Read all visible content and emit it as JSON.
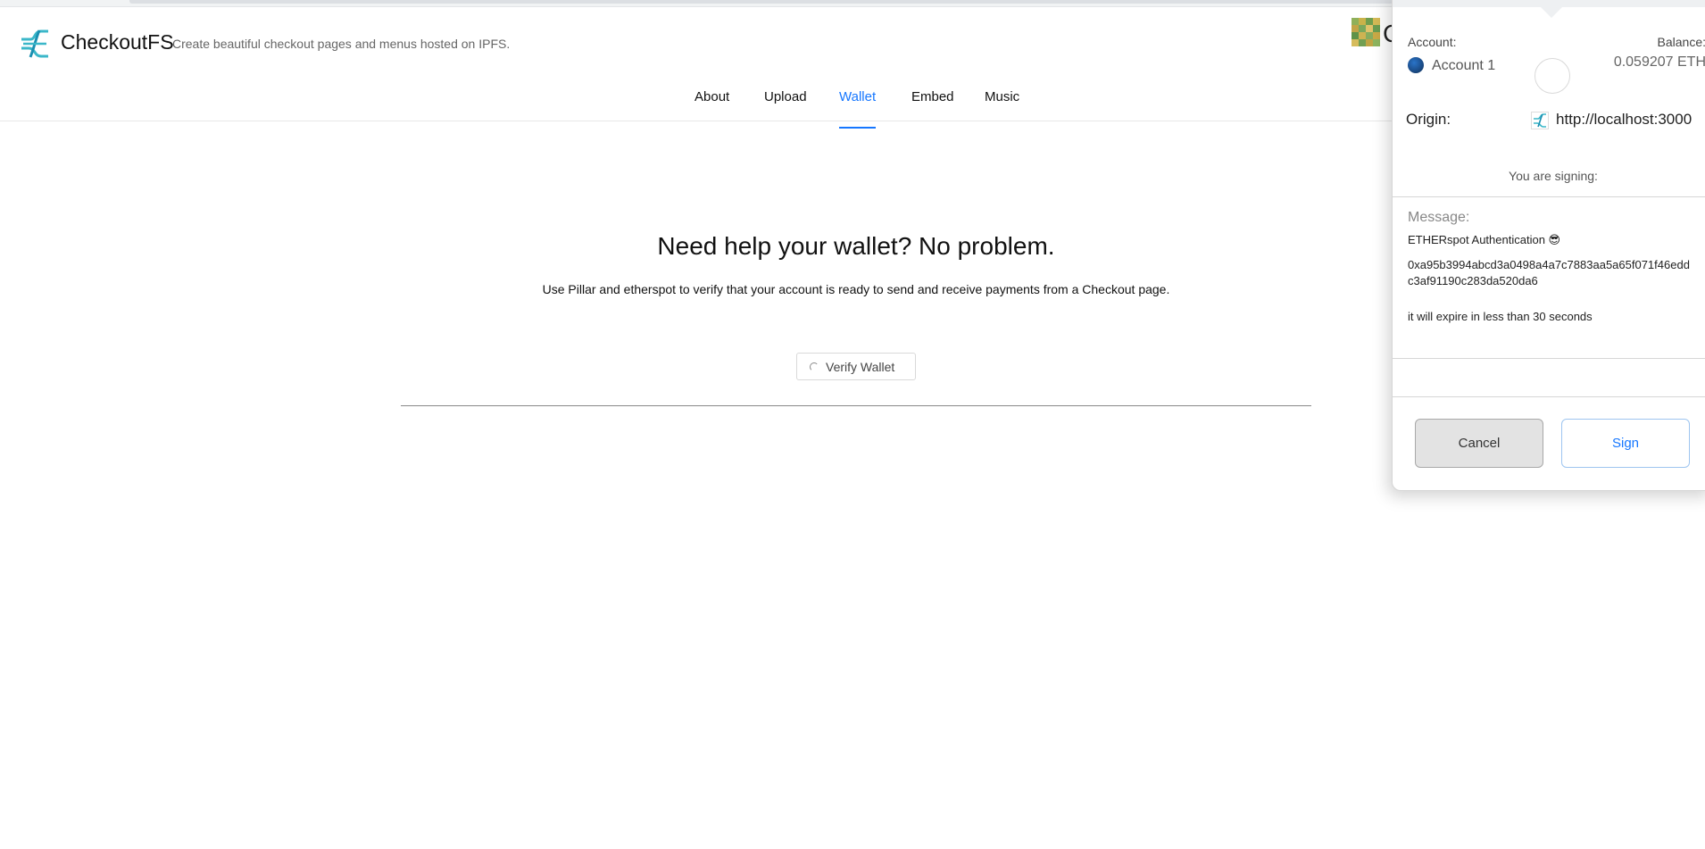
{
  "header": {
    "app_name": "CheckoutFS",
    "tagline": "Create beautiful checkout pages and menus hosted on IPFS.",
    "avatar_letter": "C"
  },
  "nav": {
    "items": [
      {
        "label": "About"
      },
      {
        "label": "Upload"
      },
      {
        "label": "Wallet",
        "active": true
      },
      {
        "label": "Embed"
      },
      {
        "label": "Music"
      }
    ]
  },
  "main": {
    "heading": "Need help your wallet? No problem.",
    "subtext": "Use Pillar and etherspot to verify that your account is ready to send and receive payments from a Checkout page.",
    "verify_button": "Verify Wallet"
  },
  "signing_popup": {
    "account_label": "Account:",
    "account_name": "Account 1",
    "balance_label": "Balance:",
    "balance_value": "0.059207 ETH",
    "origin_label": "Origin:",
    "origin_url": "http://localhost:3000",
    "signing_note": "You are signing:",
    "message_label": "Message:",
    "message_title": "ETHERspot Authentication 😎",
    "message_hash": "0xa95b3994abcd3a0498a4a7c7883aa5a65f071f46eddc3af91190c283da520da6",
    "message_expiry": "it will expire in less than 30 seconds",
    "cancel_button": "Cancel",
    "sign_button": "Sign"
  },
  "colors": {
    "accent": "#1677ff",
    "logo_teal": "#3bb7c9"
  },
  "icons": {
    "logo": "checkoutfs-logo-icon",
    "spinner": "loading-spinner-icon",
    "account": "account-identicon",
    "origin": "site-favicon-icon"
  }
}
